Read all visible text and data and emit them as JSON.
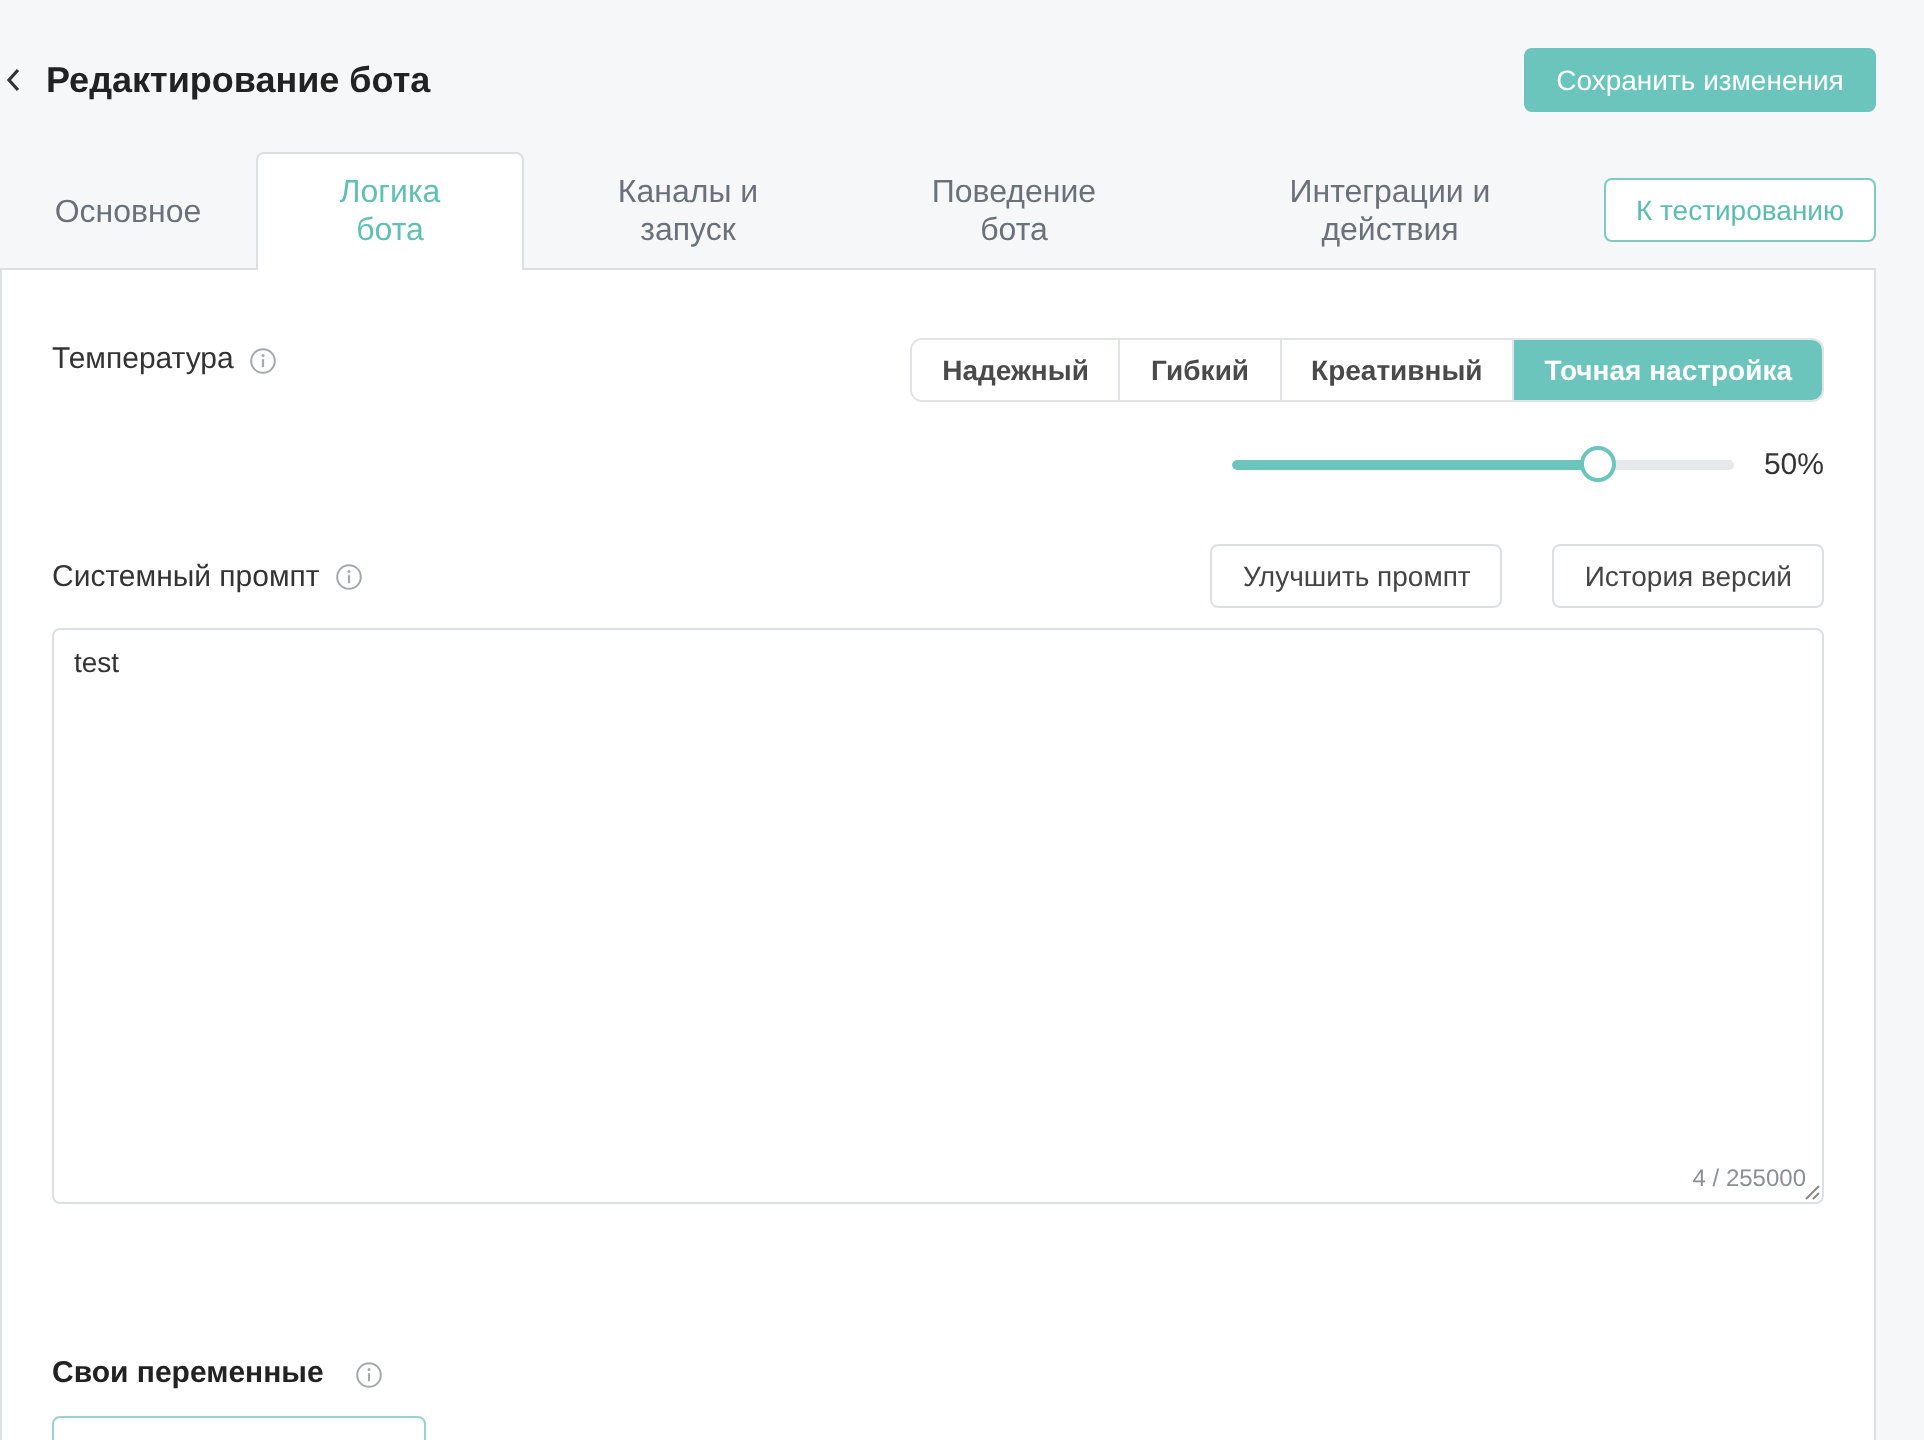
{
  "header": {
    "title": "Редактирование бота",
    "save_button": "Сохранить изменения"
  },
  "tabs": [
    {
      "label": "Основное",
      "selected": false
    },
    {
      "label": "Логика бота",
      "selected": true
    },
    {
      "label": "Каналы и запуск",
      "selected": false
    },
    {
      "label": "Поведение бота",
      "selected": false
    },
    {
      "label": "Интеграции и действия",
      "selected": false
    }
  ],
  "test_button": "К тестированию",
  "temperature": {
    "label": "Температура",
    "modes": [
      {
        "label": "Надежный",
        "selected": false
      },
      {
        "label": "Гибкий",
        "selected": false
      },
      {
        "label": "Креативный",
        "selected": false
      },
      {
        "label": "Точная настройка",
        "selected": true
      }
    ],
    "slider": {
      "level": 0.73,
      "reading": "50%"
    }
  },
  "system_prompt": {
    "label": "Системный промпт",
    "buttons": [
      "Улучшить промпт",
      "История версий"
    ],
    "value": "test",
    "counter": "4 / 255000"
  },
  "variables": {
    "label": "Свои переменные"
  }
}
